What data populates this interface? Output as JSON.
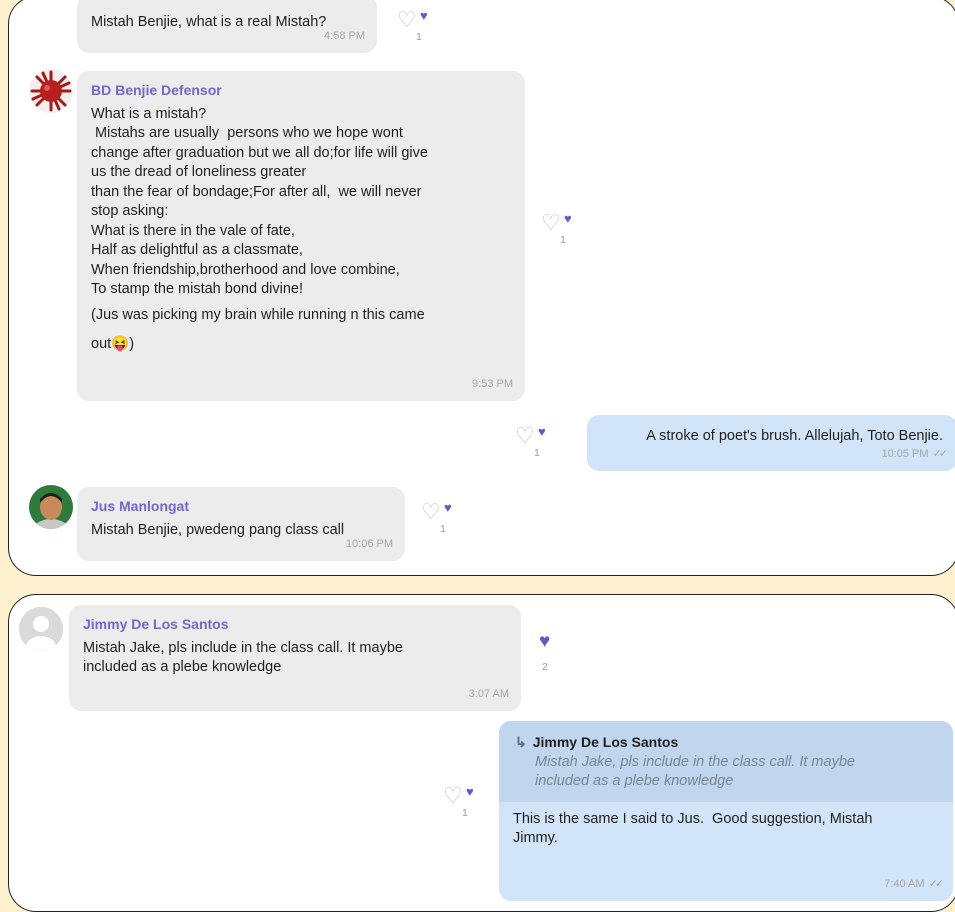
{
  "colors": {
    "page_background": "#fdf1cf",
    "accent_purple": "#7a64c9",
    "incoming_bubble": "#ececec",
    "outgoing_bubble": "#d2e4f7"
  },
  "panel1": {
    "messages": [
      {
        "text": "Mistah Benjie, what is a real Mistah?",
        "time": "4:58 PM",
        "reaction_count": "1"
      },
      {
        "sender": "BD Benjie Defensor",
        "lines": [
          "What is a mistah?",
          " Mistahs are usually  persons who we hope wont",
          "change after graduation but we all do;for life will give",
          "us the dread of loneliness greater",
          "than the fear of bondage;For after all,  we will never",
          "stop asking:",
          "What is there in the vale of fate,",
          "Half as delightful as a classmate,",
          "When friendship,brotherhood and love combine,",
          "To stamp the mistah bond divine!",
          "(Jus was picking my brain while running n this came",
          "out😝)"
        ],
        "time": "9:53 PM",
        "reaction_count": "1"
      },
      {
        "text": "A stroke of poet's brush. Allelujah, Toto Benjie.",
        "time": "10:05 PM",
        "reaction_count": "1"
      },
      {
        "sender": "Jus Manlongat",
        "text": "Mistah Benjie, pwedeng pang class call",
        "time": "10:06 PM",
        "reaction_count": "1"
      }
    ]
  },
  "panel2": {
    "messages": [
      {
        "sender": "Jimmy De Los Santos",
        "lines": [
          "Mistah Jake, pls include in the class call. It maybe",
          "included as a plebe knowledge"
        ],
        "time": "3:07 AM",
        "reaction_count": "2"
      },
      {
        "reply_to": {
          "name": "Jimmy De Los Santos",
          "lines": [
            "Mistah Jake, pls include in the class call. It maybe",
            "included as a plebe knowledge"
          ]
        },
        "lines": [
          "This is the same I said to Jus.  Good suggestion, Mistah",
          "Jimmy."
        ],
        "time": "7:40 AM",
        "reaction_count": "1"
      }
    ]
  },
  "icons": {
    "heart_outline": "♡",
    "heart_filled": "♥",
    "reply_arrow": "↳",
    "read_ticks": "✓✓"
  }
}
